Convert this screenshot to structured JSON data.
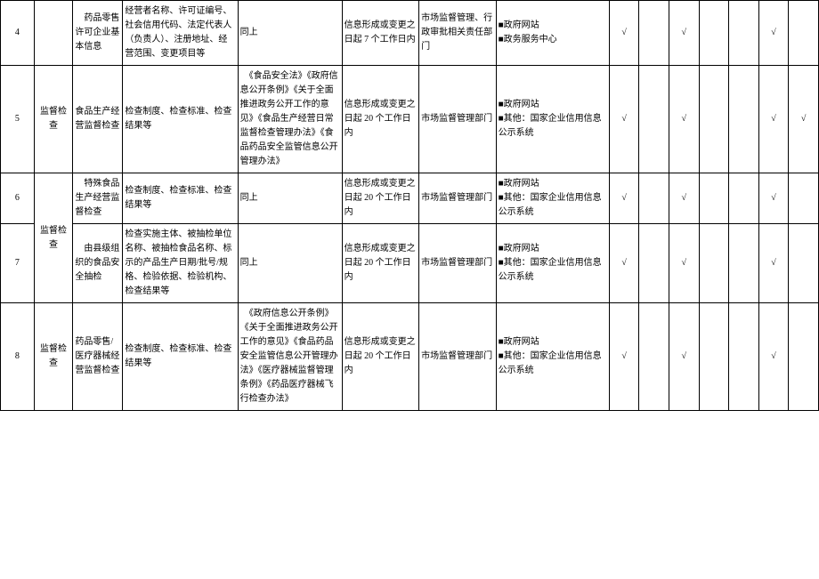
{
  "rows": [
    {
      "idx": "4",
      "cat": "",
      "sub": "　药品零售许可企业基本信息",
      "content": "经营者名称、许可证编号、社会信用代码、法定代表人（负责人）、注册地址、经营范围、变更项目等",
      "basis": "同上",
      "timing": "信息形成或变更之日起 7 个工作日内",
      "resp": "市场监督管理、行政审批相关责任部门",
      "channel": "■政府网站\n■政务服务中心",
      "chk": [
        "√",
        "",
        "√",
        "",
        "",
        "√",
        ""
      ]
    },
    {
      "idx": "5",
      "cat": "监督检查",
      "sub": "食品生产经营监督检查",
      "content": "检查制度、检查标准、检查结果等",
      "basis": "　《食品安全法》《政府信息公开条例》《关于全面推进政务公开工作的意见》《食品生产经营日常监督检查管理办法》《食品药品安全监管信息公开管理办法》",
      "timing": "信息形成或变更之日起 20 个工作日内",
      "resp": "市场监督管理部门",
      "channel": "■政府网站\n■其他：国家企业信用信息公示系统",
      "chk": [
        "√",
        "",
        "√",
        "",
        "",
        "√",
        "√"
      ]
    },
    {
      "idx": "6",
      "cat": "",
      "sub": "　特殊食品生产经营监督检查",
      "content": "检查制度、检查标准、检查结果等",
      "basis": "同上",
      "timing": "信息形成或变更之日起 20 个工作日内",
      "resp": "市场监督管理部门",
      "channel": "■政府网站\n■其他：国家企业信用信息公示系统",
      "chk": [
        "√",
        "",
        "√",
        "",
        "",
        "√",
        ""
      ]
    },
    {
      "idx": "7",
      "cat": "",
      "sub": "　由县级组织的食品安全抽检",
      "content": "检查实施主体、被抽检单位名称、被抽检食品名称、标示的产品生产日期/批号/规格、检验依据、检验机构、检查结果等",
      "basis": "同上",
      "timing": "信息形成或变更之日起 20 个工作日内",
      "resp": "市场监督管理部门",
      "channel": "■政府网站\n■其他：国家企业信用信息公示系统",
      "chk": [
        "√",
        "",
        "√",
        "",
        "",
        "√",
        ""
      ]
    },
    {
      "idx": "8",
      "cat": "监督检查",
      "sub": "药品零售/医疗器械经营监督检查",
      "content": "检查制度、检查标准、检查结果等",
      "basis": "　《政府信息公开条例》《关于全面推进政务公开工作的意见》《食品药品安全监管信息公开管理办法》《医疗器械监督管理条例》《药品医疗器械飞行检查办法》",
      "timing": "信息形成或变更之日起 20 个工作日内",
      "resp": "市场监督管理部门",
      "channel": "■政府网站\n■其他：国家企业信用信息公示系统",
      "chk": [
        "√",
        "",
        "√",
        "",
        "",
        "√",
        ""
      ]
    }
  ],
  "merged_cat_label": "监督检查"
}
